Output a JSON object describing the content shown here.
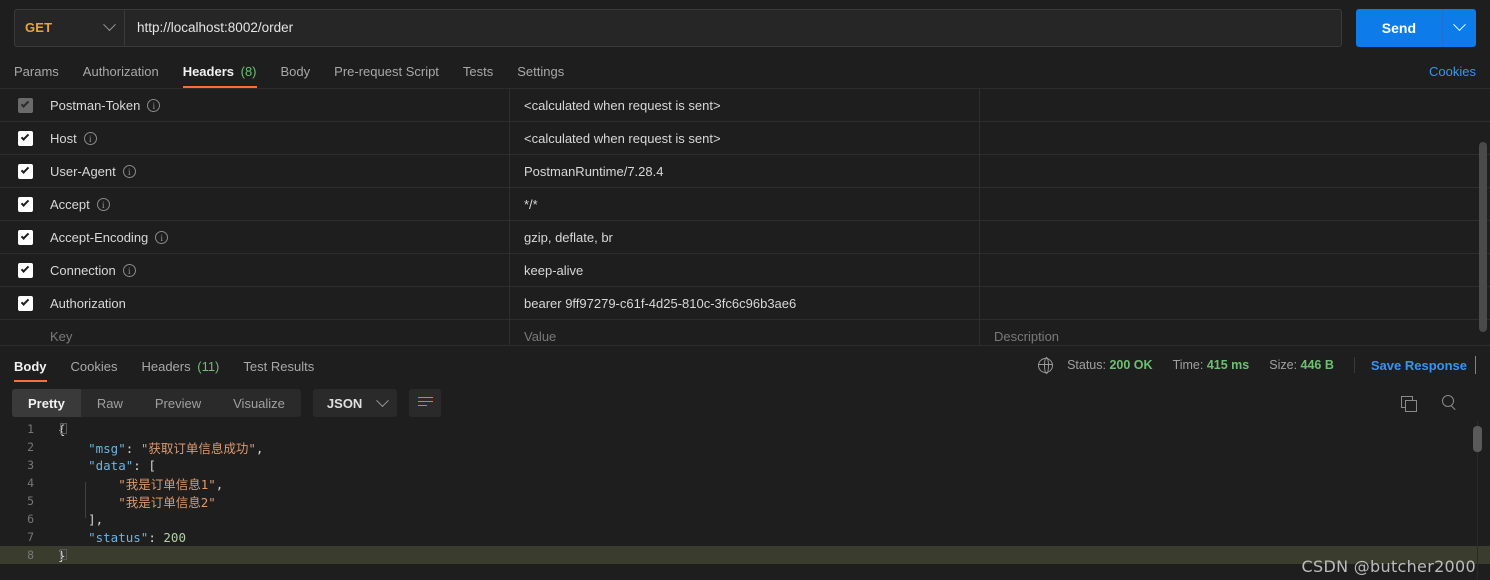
{
  "request": {
    "method": "GET",
    "url": "http://localhost:8002/order",
    "send_label": "Send",
    "tabs": [
      {
        "label": "Params",
        "count": null,
        "active": false
      },
      {
        "label": "Authorization",
        "count": null,
        "active": false
      },
      {
        "label": "Headers",
        "count": "(8)",
        "active": true
      },
      {
        "label": "Body",
        "count": null,
        "active": false
      },
      {
        "label": "Pre-request Script",
        "count": null,
        "active": false
      },
      {
        "label": "Tests",
        "count": null,
        "active": false
      },
      {
        "label": "Settings",
        "count": null,
        "active": false
      }
    ],
    "cookies_link": "Cookies"
  },
  "headers_table": {
    "columns": {
      "key": "Key",
      "value": "Value",
      "description": "Description"
    },
    "rows": [
      {
        "checked": true,
        "disabled": true,
        "key": "Postman-Token",
        "info": true,
        "value": "<calculated when request is sent>",
        "description": ""
      },
      {
        "checked": true,
        "disabled": false,
        "key": "Host",
        "info": true,
        "value": "<calculated when request is sent>",
        "description": ""
      },
      {
        "checked": true,
        "disabled": false,
        "key": "User-Agent",
        "info": true,
        "value": "PostmanRuntime/7.28.4",
        "description": ""
      },
      {
        "checked": true,
        "disabled": false,
        "key": "Accept",
        "info": true,
        "value": "*/*",
        "description": ""
      },
      {
        "checked": true,
        "disabled": false,
        "key": "Accept-Encoding",
        "info": true,
        "value": "gzip, deflate, br",
        "description": ""
      },
      {
        "checked": true,
        "disabled": false,
        "key": "Connection",
        "info": true,
        "value": "keep-alive",
        "description": ""
      },
      {
        "checked": true,
        "disabled": false,
        "key": "Authorization",
        "info": false,
        "value": "bearer 9ff97279-c61f-4d25-810c-3fc6c96b3ae6",
        "description": ""
      }
    ]
  },
  "response": {
    "tabs": [
      {
        "label": "Body",
        "count": null,
        "active": true
      },
      {
        "label": "Cookies",
        "count": null,
        "active": false
      },
      {
        "label": "Headers",
        "count": "(11)",
        "active": false
      },
      {
        "label": "Test Results",
        "count": null,
        "active": false
      }
    ],
    "status_label": "Status:",
    "status_value": "200 OK",
    "time_label": "Time:",
    "time_value": "415 ms",
    "size_label": "Size:",
    "size_value": "446 B",
    "save_response": "Save Response",
    "view_modes": [
      {
        "label": "Pretty",
        "active": true
      },
      {
        "label": "Raw",
        "active": false
      },
      {
        "label": "Preview",
        "active": false
      },
      {
        "label": "Visualize",
        "active": false
      }
    ],
    "format": "JSON",
    "body_lines": [
      {
        "no": "1",
        "tokens": [
          {
            "t": "{",
            "c": "pun"
          }
        ],
        "current": false
      },
      {
        "no": "2",
        "tokens": [
          {
            "t": "    ",
            "c": "pun"
          },
          {
            "t": "\"msg\"",
            "c": "key"
          },
          {
            "t": ": ",
            "c": "pun"
          },
          {
            "t": "\"获取订单信息成功\"",
            "c": "str"
          },
          {
            "t": ",",
            "c": "pun"
          }
        ],
        "current": false
      },
      {
        "no": "3",
        "tokens": [
          {
            "t": "    ",
            "c": "pun"
          },
          {
            "t": "\"data\"",
            "c": "key"
          },
          {
            "t": ": [",
            "c": "pun"
          }
        ],
        "current": false
      },
      {
        "no": "4",
        "tokens": [
          {
            "t": "        ",
            "c": "pun"
          },
          {
            "t": "\"我是订单信息1\"",
            "c": "str"
          },
          {
            "t": ",",
            "c": "pun"
          }
        ],
        "current": false
      },
      {
        "no": "5",
        "tokens": [
          {
            "t": "        ",
            "c": "pun"
          },
          {
            "t": "\"我是订单信息2\"",
            "c": "str"
          }
        ],
        "current": false
      },
      {
        "no": "6",
        "tokens": [
          {
            "t": "    ],",
            "c": "pun"
          }
        ],
        "current": false
      },
      {
        "no": "7",
        "tokens": [
          {
            "t": "    ",
            "c": "pun"
          },
          {
            "t": "\"status\"",
            "c": "key"
          },
          {
            "t": ": ",
            "c": "pun"
          },
          {
            "t": "200",
            "c": "num"
          }
        ],
        "current": false
      },
      {
        "no": "8",
        "tokens": [
          {
            "t": "}",
            "c": "pun"
          }
        ],
        "current": true
      }
    ]
  },
  "watermark": "CSDN @butcher2000",
  "colors": {
    "accent_orange": "#ff6c37",
    "link_blue": "#3793f5",
    "send_blue": "#0d7ce8",
    "method_orange": "#e8a33d",
    "success_green": "#6cc070",
    "json_key": "#6fb3e0",
    "json_string": "#d99b72",
    "json_number": "#b5cea8",
    "background": "#1e1e1e"
  }
}
